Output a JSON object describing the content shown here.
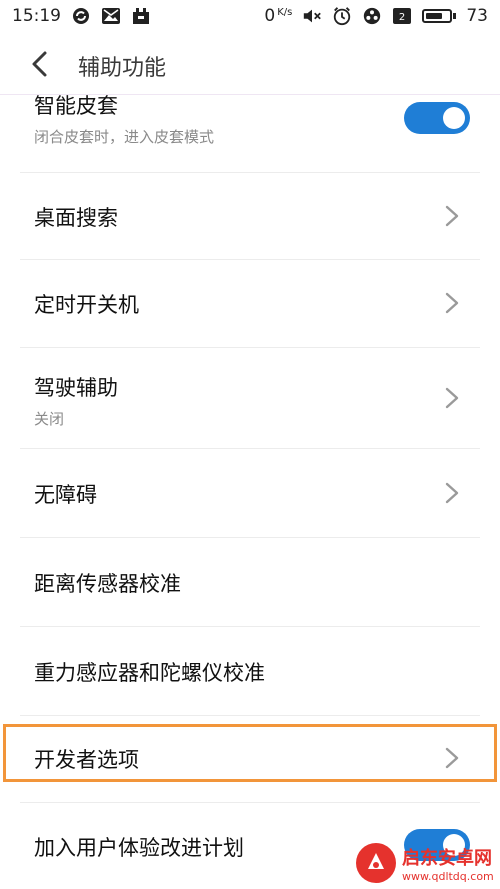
{
  "status_bar": {
    "time": "15:19",
    "net_speed": "0",
    "net_unit": "K/s",
    "battery_level": "73",
    "battery_fraction": 0.73,
    "icons": [
      "sync-icon",
      "image-icon",
      "notification-icon",
      "mute-icon",
      "alarm-icon",
      "app-icon",
      "sim-icon",
      "battery-icon"
    ]
  },
  "header": {
    "title": "辅助功能",
    "back_icon": "chevron-left-icon"
  },
  "items": [
    {
      "title": "智能皮套",
      "subtitle": "闭合皮套时，进入皮套模式",
      "control": "toggle",
      "on": true
    },
    {
      "title": "桌面搜索",
      "control": "chevron"
    },
    {
      "title": "定时开关机",
      "control": "chevron"
    },
    {
      "title": "驾驶辅助",
      "subtitle": "关闭",
      "control": "chevron"
    },
    {
      "title": "无障碍",
      "control": "chevron"
    },
    {
      "title": "距离传感器校准",
      "control": "none"
    },
    {
      "title": "重力感应器和陀螺仪校准",
      "control": "none"
    },
    {
      "title": "开发者选项",
      "control": "chevron",
      "highlighted": true
    },
    {
      "title": "加入用户体验改进计划",
      "control": "toggle",
      "on": true
    }
  ],
  "colors": {
    "accent": "#1f7ed6",
    "highlight": "#f2953a",
    "watermark": "#e5322d"
  },
  "watermark": {
    "name": "启东安卓网",
    "url": "www.qdltdq.com"
  }
}
